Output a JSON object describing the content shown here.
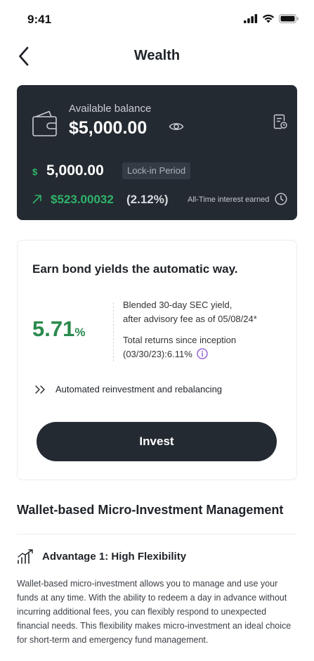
{
  "status_bar": {
    "time": "9:41",
    "icons": [
      "signal-icon",
      "wifi-icon",
      "battery-icon"
    ]
  },
  "nav": {
    "title": "Wealth",
    "back_icon": "chevron-left-icon"
  },
  "balance_card": {
    "available_label": "Available balance",
    "available_amount": "$5,000.00",
    "currency_symbol": "$",
    "locked_amount": "5,000.00",
    "lock_badge": "Lock-in Period",
    "interest_amount": "$523.00032",
    "interest_percent": "(2.12%)",
    "interest_label": "All-Time interest earned",
    "icons": [
      "wallet-icon",
      "eye-icon",
      "statement-icon",
      "trend-up-icon",
      "clock-icon"
    ]
  },
  "yield_card": {
    "title": "Earn bond yields the automatic way.",
    "rate_value": "5.71",
    "rate_unit": "%",
    "yield_line1": "Blended 30-day SEC yield,",
    "yield_line2": "after advisory fee as of 05/08/24*",
    "returns_line1": "Total returns since inception",
    "returns_line2": "(03/30/23):6.11%",
    "auto_text": "Automated reinvestment and rebalancing",
    "invest_label": "Invest"
  },
  "section": {
    "title": "Wallet-based Micro-Investment Management",
    "advantage_title": "Advantage 1: High Flexibility",
    "advantage_body": "Wallet-based micro-investment allows you to manage and use your funds at any time. With the ability to redeem a day in advance without incurring additional fees, you can flexibly respond to unexpected financial needs. This flexibility makes micro-investment an ideal choice for short-term and emergency fund management."
  },
  "colors": {
    "card_dark": "#242a31",
    "accent_green": "#2fb36b",
    "rate_green": "#2a8a4e",
    "info_purple": "#8a4fd6"
  }
}
